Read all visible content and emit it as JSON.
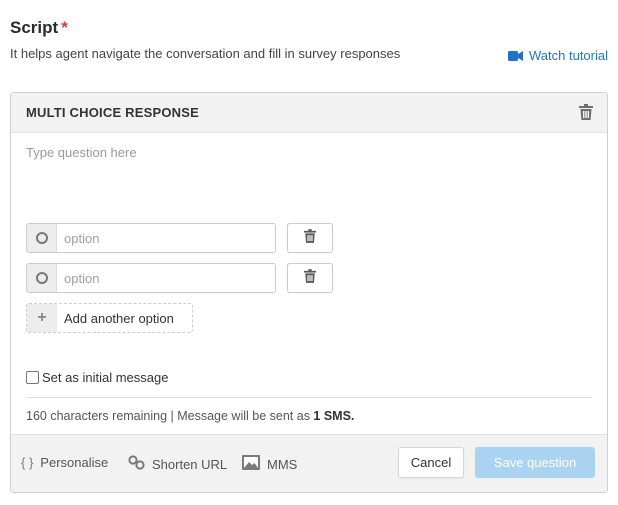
{
  "header": {
    "title": "Script",
    "required_mark": "*",
    "subtitle": "It helps agent navigate the conversation and fill in survey responses",
    "watch_tutorial": "Watch tutorial"
  },
  "card": {
    "title": "MULTI CHOICE RESPONSE",
    "question_placeholder": "Type question here",
    "question_value": "",
    "options": [
      {
        "placeholder": "option",
        "value": ""
      },
      {
        "placeholder": "option",
        "value": ""
      }
    ],
    "add_option_label": "Add another option",
    "initial_message_label": "Set as initial message",
    "initial_message_checked": false,
    "char_info_prefix": "160 characters remaining | Message will be sent as ",
    "char_info_sms": "1 SMS."
  },
  "footer": {
    "personalise": "Personalise",
    "personalise_icon": "{ }",
    "shorten_url": "Shorten URL",
    "mms": "MMS",
    "cancel": "Cancel",
    "save": "Save question"
  },
  "colors": {
    "link": "#1f74c4",
    "required": "#e0383e",
    "save_button_disabled": "#a9d3f1"
  }
}
